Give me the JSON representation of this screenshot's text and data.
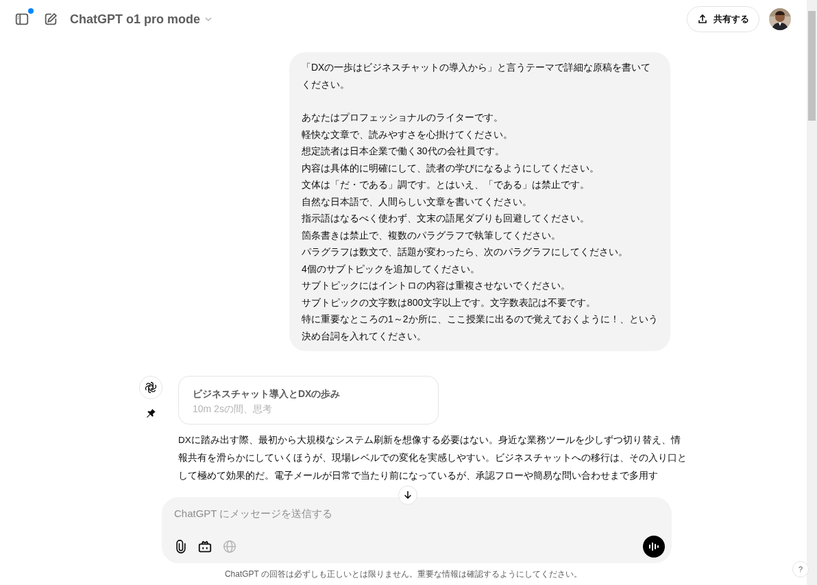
{
  "header": {
    "model": "ChatGPT o1 pro mode",
    "share_label": "共有する",
    "sidebar_notification": true
  },
  "user_message": {
    "paragraphs": [
      {
        "lines": [
          "「DXの一歩はビジネスチャットの導入から」と言うテーマで詳細な原稿を書いてください。"
        ]
      },
      {
        "lines": [
          "あなたはプロフェッショナルのライターです。",
          "軽快な文章で、読みやすさを心掛けてください。",
          "想定読者は日本企業で働く30代の会社員です。",
          "内容は具体的に明確にして、読者の学びになるようにしてください。",
          "文体は「だ・である」調です。とはいえ、「である」は禁止です。",
          "自然な日本語で、人間らしい文章を書いてください。",
          "指示語はなるべく使わず、文末の語尾ダブりも回避してください。",
          "箇条書きは禁止で、複数のパラグラフで執筆してください。",
          "パラグラフは数文で、話題が変わったら、次のパラグラフにしてください。",
          "4個のサブトピックを追加してください。",
          "サブトピックにはイントロの内容は重複させないでください。",
          "サブトピックの文字数は800文字以上です。文字数表記は不要です。",
          "特に重要なところの1～2か所に、ここ授業に出るので覚えておくように！、という決め台詞を入れてください。"
        ]
      }
    ]
  },
  "reasoning": {
    "title": "ビジネスチャット導入とDXの歩み",
    "duration": "10m 2sの間、思考"
  },
  "assistant_text": "DXに踏み出す際、最初から大規模なシステム刷新を想像する必要はない。身近な業務ツールを少しずつ切り替え、情報共有を滑らかにしていくほうが、現場レベルでの変化を実感しやすい。ビジネスチャットへの移行は、その入り口として極めて効果的だ。電子メールが日常で当たり前になっているが、承認フローや簡易な問い合わせまで多用す",
  "composer": {
    "placeholder": "ChatGPT にメッセージを送信する",
    "search_enabled": false
  },
  "footer": {
    "disclaimer": "ChatGPT の回答は必ずしも正しいとは限りません。重要な情報は確認するようにしてください。",
    "help": "?"
  }
}
